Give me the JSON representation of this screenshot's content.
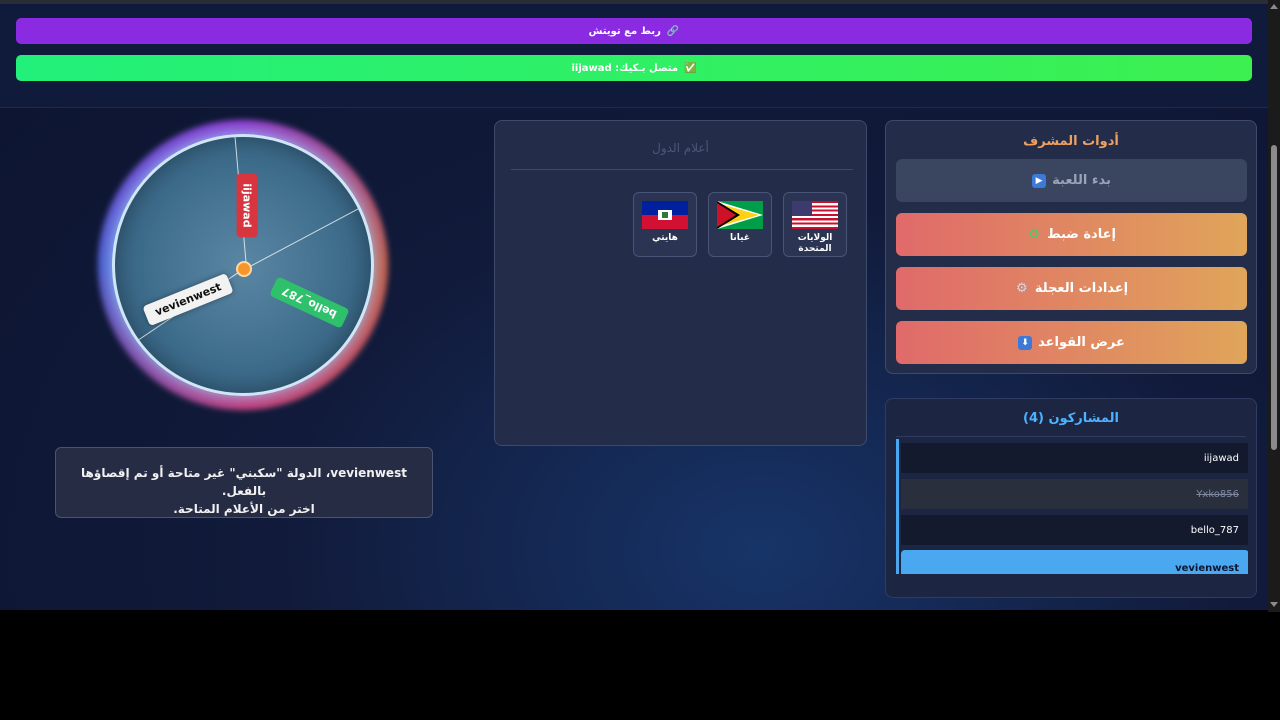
{
  "header": {
    "twitch_label": "ربط مع تويتش",
    "twitch_icon": "link-icon",
    "connected_label": "متصل بـكيك: iijawad",
    "connected_icon": "check-icon"
  },
  "wheel": {
    "entries": [
      "iijawad",
      "bello_787",
      "vevienwest"
    ]
  },
  "message": {
    "line1": "vevienwest، الدولة \"سكبني\" غير متاحة أو تم إقصاؤها بالفعل.",
    "line2": "اختر من الأعلام المتاحة."
  },
  "flags": {
    "title": "أعلام الدول",
    "items": [
      {
        "name": "الولايات المتحدة",
        "flag": "us-flag"
      },
      {
        "name": "غيانا",
        "flag": "guyana-flag"
      },
      {
        "name": "هايتي",
        "flag": "haiti-flag"
      }
    ]
  },
  "moderator": {
    "title": "أدوات المشرف",
    "buttons": [
      {
        "label": "بدء اللعبة",
        "icon": "play-icon"
      },
      {
        "label": "إعادة ضبط",
        "icon": "recycle-icon"
      },
      {
        "label": "إعدادات العجلة",
        "icon": "gear-icon"
      },
      {
        "label": "عرض القواعد",
        "icon": "down-arrow-icon"
      }
    ]
  },
  "participants": {
    "title": "المشاركون (4)",
    "rows": [
      "iijawad",
      "Yxko856",
      "bello_787",
      "vevienwest"
    ]
  }
}
